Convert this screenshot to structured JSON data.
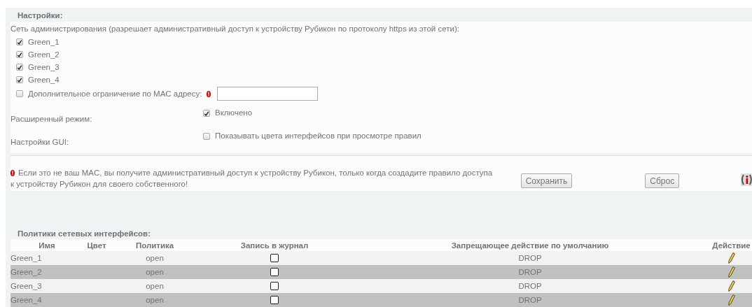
{
  "settings": {
    "title": "Настройки:",
    "admin_network": {
      "label": "Сеть администрирования (разрешает административный доступ к устройству Рубикон по протоколу https из этой сети):",
      "interfaces": [
        {
          "label": "Green_1",
          "checked": true
        },
        {
          "label": "Green_2",
          "checked": true
        },
        {
          "label": "Green_3",
          "checked": true
        },
        {
          "label": "Green_4",
          "checked": true
        }
      ],
      "mac_restriction": {
        "label": "Дополнительное ограничение по MAC адресу:",
        "checked": false
      }
    },
    "advanced_mode": {
      "label": "Расширенный режим:",
      "option_label": "Включено",
      "checked": true
    },
    "gui": {
      "label": "Настройки GUI:",
      "option_label": "Показывать цвета интерфейсов при просмотре правил",
      "checked": false
    },
    "message": "Если это не ваш MAC, вы получите административный доступ к устройству Рубикон, только когда создадите правило доступа к устройству Рубикон для своего собственного!",
    "buttons": [
      "Сохранить",
      "Сброс"
    ]
  },
  "policies": {
    "title": "Политики сетевых интерфейсов:",
    "columns": [
      "Имя",
      "Цвет",
      "Политика",
      "Запись в журнал",
      "Запрещающее действие по умолчанию",
      "Действие"
    ],
    "rows": [
      {
        "name": "Green_1",
        "policy": "open",
        "log": false,
        "default_action": "DROP"
      },
      {
        "name": "Green_2",
        "policy": "open",
        "log": false,
        "default_action": "DROP"
      },
      {
        "name": "Green_3",
        "policy": "open",
        "log": false,
        "default_action": "DROP"
      },
      {
        "name": "Green_4",
        "policy": "open",
        "log": false,
        "default_action": "DROP"
      }
    ]
  }
}
